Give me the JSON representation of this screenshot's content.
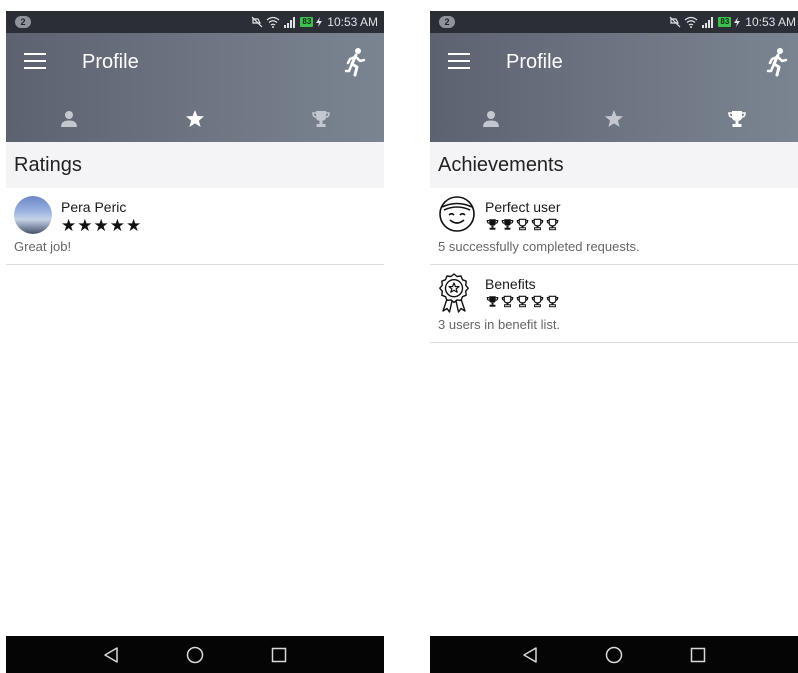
{
  "screens": {
    "left": {
      "status": {
        "notifications": "2",
        "battery": "83",
        "time": "10:53 AM"
      },
      "title": "Profile",
      "active_tab": "ratings",
      "section_title": "Ratings",
      "ratings": [
        {
          "user": "Pera Peric",
          "stars": "★★★★★",
          "stars_value": 5,
          "comment": "Great job!"
        }
      ]
    },
    "right": {
      "status": {
        "notifications": "2",
        "battery": "83",
        "time": "10:53 AM"
      },
      "title": "Profile",
      "active_tab": "achievements",
      "section_title": "Achievements",
      "achievements": [
        {
          "title": "Perfect user",
          "icon": "smiley-face-icon",
          "level": 2,
          "level_max": 5,
          "description": "5 successfully completed requests."
        },
        {
          "title": "Benefits",
          "icon": "award-ribbon-icon",
          "level": 1,
          "level_max": 5,
          "description": "3 users in benefit list."
        }
      ]
    }
  },
  "tabs": [
    {
      "id": "info",
      "icon": "person-icon"
    },
    {
      "id": "ratings",
      "icon": "star-icon"
    },
    {
      "id": "achievements",
      "icon": "trophy-icon"
    }
  ],
  "icons": {
    "menu": "hamburger-menu-icon",
    "action": "running-person-icon"
  },
  "colors": {
    "appbar": "#6f7683",
    "status_bar": "#2b2e35",
    "section_header": "#f4f4f7",
    "tab_active": "#ffffff",
    "tab_inactive": "#c3c8d0",
    "battery": "#3fbf50"
  }
}
